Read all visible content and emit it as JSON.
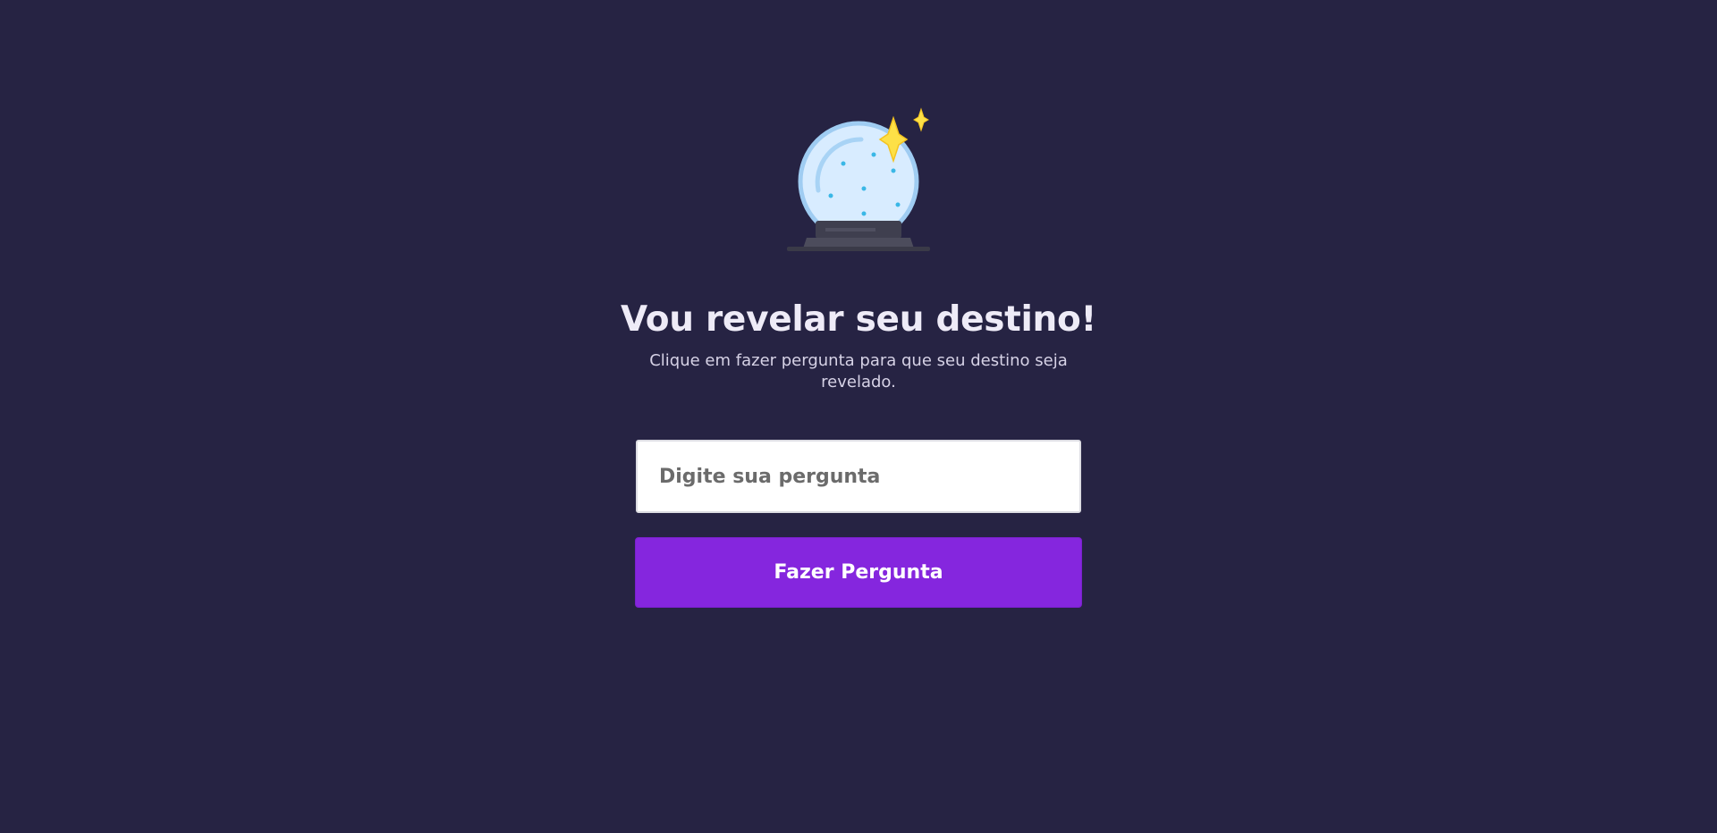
{
  "hero": {
    "icon": "crystal-ball-icon",
    "title": "Vou revelar seu destino!",
    "subtitle": "Clique em fazer pergunta para que seu destino seja revelado."
  },
  "form": {
    "question_placeholder": "Digite sua pergunta",
    "question_value": "",
    "ask_button_label": "Fazer Pergunta"
  },
  "colors": {
    "background": "#262343",
    "button": "#8526de",
    "sparkle": "#fde047",
    "globe": "#d8ecff"
  }
}
